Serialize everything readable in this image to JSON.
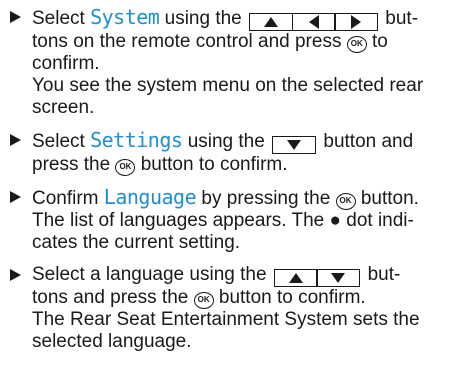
{
  "steps": [
    {
      "t1": "Select ",
      "hl": "System",
      "t2": " using the ",
      "t3": " but-",
      "l2": "tons on the remote control and press ",
      "ok": "OK",
      "t4": " to",
      "l3": "confirm.",
      "n1": "You see the system menu on the selected rear",
      "n2": "screen."
    },
    {
      "t1": "Select ",
      "hl": "Settings",
      "t2": " using the ",
      "t3": " button and",
      "l2a": "press the ",
      "ok": "OK",
      "l2b": " button to confirm."
    },
    {
      "t1": "Confirm ",
      "hl": "Language",
      "t2": " by pressing the ",
      "ok": "OK",
      "t3": " button.",
      "n1": "The list of languages appears. The ● dot indi-",
      "n2": "cates the current setting."
    },
    {
      "t1": "Select a language using the ",
      "t2": " but-",
      "l2a": "tons and press the ",
      "ok": "OK",
      "l2b": " button to confirm.",
      "n1": "The Rear Seat Entertainment System sets the",
      "n2": "selected language."
    }
  ],
  "icons": {
    "up": "up-arrow-icon",
    "left": "left-arrow-icon",
    "right": "right-arrow-icon",
    "down": "down-arrow-icon",
    "ok": "ok-button-icon",
    "bullet": "step-triangle-icon"
  },
  "colors": {
    "highlight": "#1f8fd0",
    "text": "#1a1a1a"
  }
}
